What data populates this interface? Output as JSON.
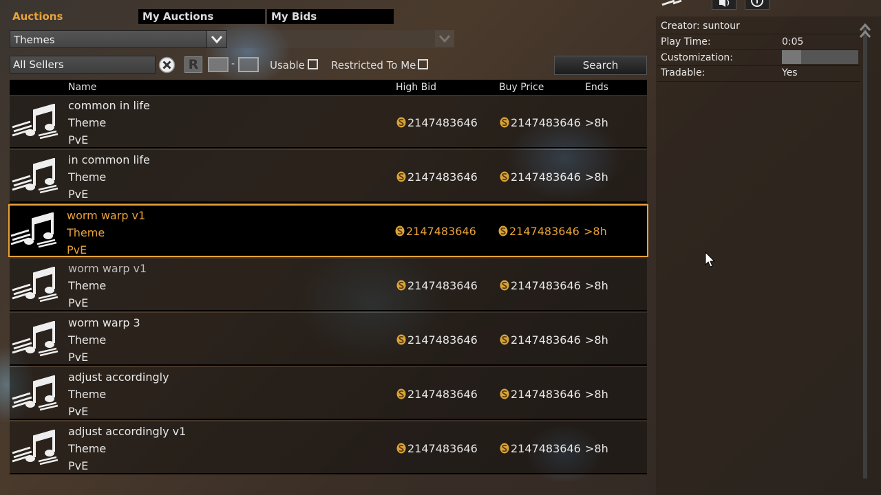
{
  "tabs": {
    "auctions": "Auctions",
    "my_auctions": "My Auctions",
    "my_bids": "My Bids"
  },
  "category": {
    "selected": "Themes"
  },
  "filters": {
    "seller_value": "All Sellers",
    "r_label": "R",
    "level_dash": "-",
    "usable_label": "Usable",
    "restricted_label": "Restricted To Me",
    "search_label": "Search"
  },
  "table": {
    "headers": {
      "name": "Name",
      "high_bid": "High Bid",
      "buy_price": "Buy Price",
      "ends": "Ends"
    },
    "rows": [
      {
        "name": "common in life",
        "type": "Theme",
        "mode": "PvE",
        "high_bid": "2147483646",
        "buy_price": "2147483646",
        "ends": ">8h"
      },
      {
        "name": "in common life",
        "type": "Theme",
        "mode": "PvE",
        "high_bid": "2147483646",
        "buy_price": "2147483646",
        "ends": ">8h"
      },
      {
        "name": "worm warp v1",
        "type": "Theme",
        "mode": "PvE",
        "high_bid": "2147483646",
        "buy_price": "2147483646",
        "ends": ">8h"
      },
      {
        "name": "worm warp v1",
        "type": "Theme",
        "mode": "PvE",
        "high_bid": "2147483646",
        "buy_price": "2147483646",
        "ends": ">8h"
      },
      {
        "name": "worm warp 3",
        "type": "Theme",
        "mode": "PvE",
        "high_bid": "2147483646",
        "buy_price": "2147483646",
        "ends": ">8h"
      },
      {
        "name": "adjust accordingly",
        "type": "Theme",
        "mode": "PvE",
        "high_bid": "2147483646",
        "buy_price": "2147483646",
        "ends": ">8h"
      },
      {
        "name": "adjust accordingly v1",
        "type": "Theme",
        "mode": "PvE",
        "high_bid": "2147483646",
        "buy_price": "2147483646",
        "ends": ">8h"
      }
    ]
  },
  "details": {
    "creator": "Creator: suntour",
    "play_time_label": "Play Time:",
    "play_time_value": "0:05",
    "customization_label": "Customization:",
    "customization_level": 0.25,
    "tradable_label": "Tradable:",
    "tradable_value": "Yes"
  },
  "colors": {
    "accent": "#e8a23a",
    "gold": "#d9a43a"
  },
  "icons": [
    "music-note-icon",
    "clear-icon",
    "chevron-down-icon",
    "coin-icon",
    "speaker-icon",
    "compass-icon",
    "scroll-up-icon",
    "mouse-cursor-icon"
  ]
}
